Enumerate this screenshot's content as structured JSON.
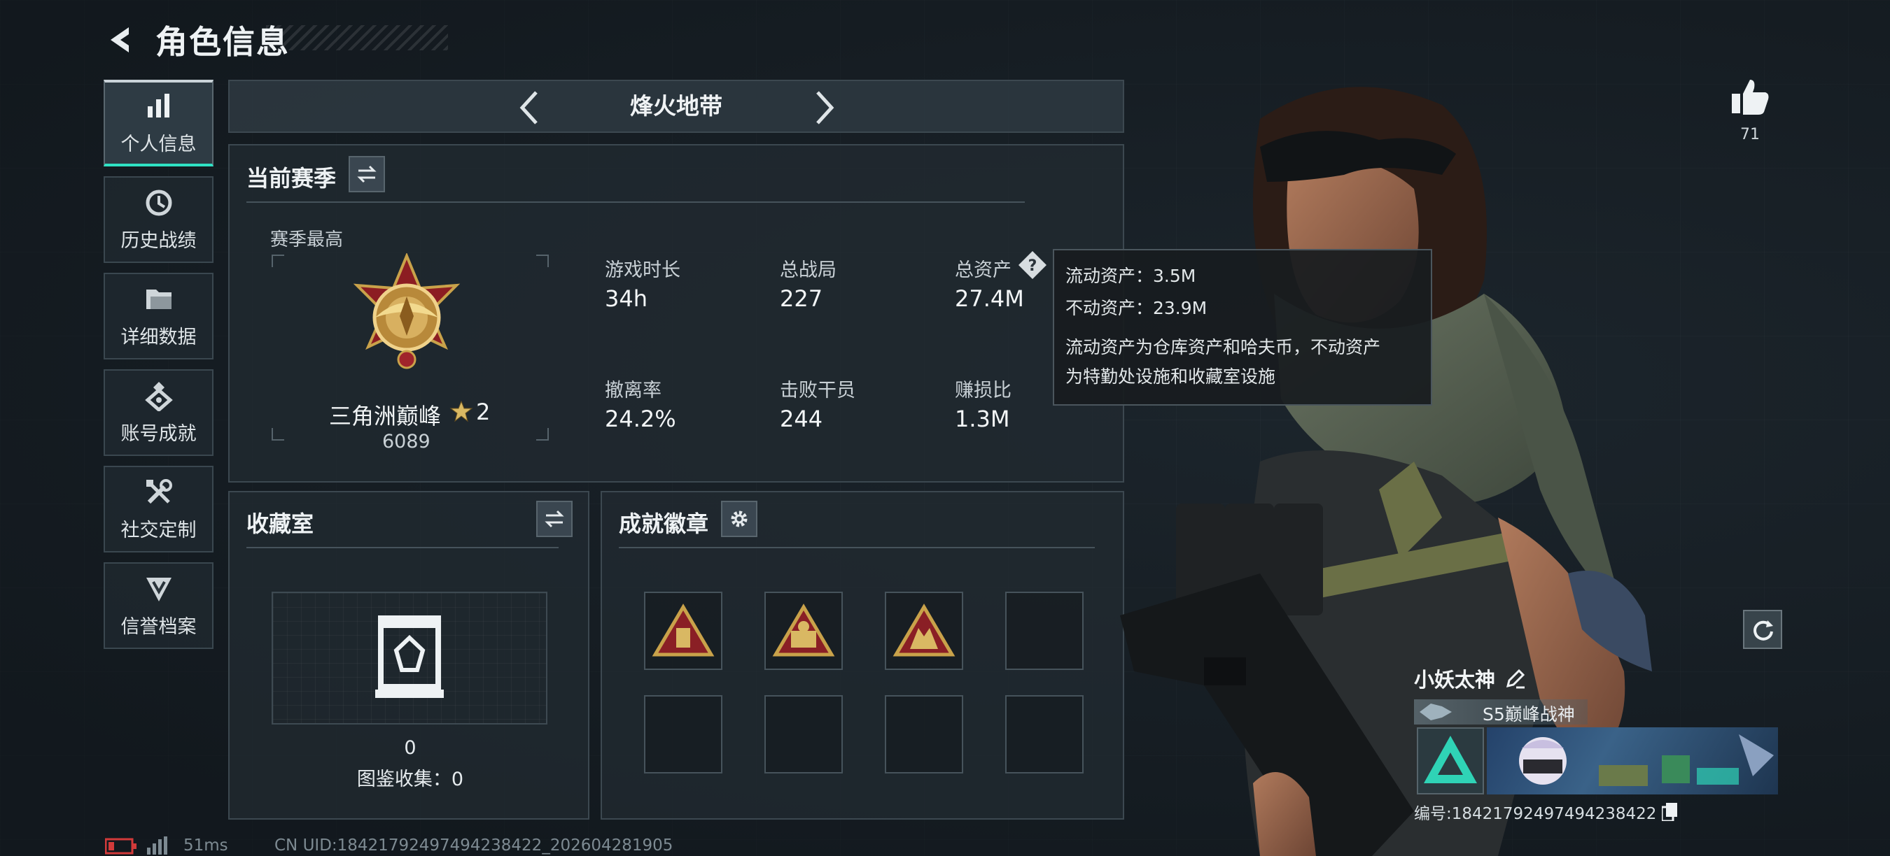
{
  "header": {
    "title": "角色信息"
  },
  "nav": {
    "items": [
      {
        "label": "个人信息",
        "icon": "bar-chart-icon",
        "active": true
      },
      {
        "label": "历史战绩",
        "icon": "history-icon"
      },
      {
        "label": "详细数据",
        "icon": "folder-icon"
      },
      {
        "label": "账号成就",
        "icon": "achievement-icon"
      },
      {
        "label": "社交定制",
        "icon": "tools-icon"
      },
      {
        "label": "信誉档案",
        "icon": "reputation-icon"
      }
    ]
  },
  "mode": {
    "title": "烽火地带"
  },
  "season": {
    "title": "当前赛季",
    "best_label": "赛季最高",
    "rank_name": "三角洲巅峰",
    "rank_stars": "2",
    "rank_score": "6089",
    "stats": [
      {
        "label": "游戏时长",
        "value": "34h"
      },
      {
        "label": "总战局",
        "value": "227"
      },
      {
        "label": "总资产",
        "value": "27.4M"
      },
      {
        "label": "撤离率",
        "value": "24.2%"
      },
      {
        "label": "击败干员",
        "value": "244"
      },
      {
        "label": "赚损比",
        "value": "1.3M"
      }
    ]
  },
  "tooltip": {
    "liquid": "流动资产：3.5M",
    "fixed": "不动资产：23.9M",
    "desc_line1": "流动资产为仓库资产和哈夫币，不动资产",
    "desc_line2": "为特勤处设施和收藏室设施"
  },
  "collection": {
    "title": "收藏室",
    "count": "0",
    "codex": "图鉴收集：0"
  },
  "badges": {
    "title": "成就徽章",
    "filled": 3,
    "total": 8
  },
  "profile": {
    "likes": "71",
    "name": "小妖太神",
    "title_tag": "S5巅峰战神",
    "id_text": "编号:18421792497494238422"
  },
  "footer": {
    "ping": "51ms",
    "uid": "CN UID:18421792497494238422_202604281905"
  },
  "colors": {
    "accent": "#2fe2c4",
    "gold": "#c9a24a",
    "tooltip_bg": "#181c1f"
  }
}
